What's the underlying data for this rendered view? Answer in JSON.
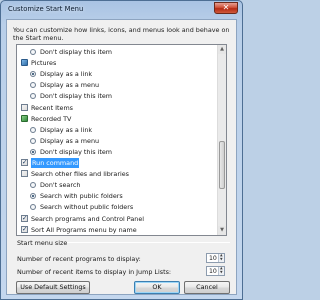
{
  "window": {
    "title": "Customize Start Menu",
    "close_glyph": "✕"
  },
  "description": "You can customize how links, icons, and menus look and behave on the Start menu.",
  "options": [
    {
      "type": "radio",
      "label": "Don't display this item",
      "checked": false,
      "indent": 1
    },
    {
      "type": "icon",
      "icon": "pictures-icon",
      "label": "Pictures",
      "indent": 0
    },
    {
      "type": "radio",
      "label": "Display as a link",
      "checked": true,
      "indent": 1
    },
    {
      "type": "radio",
      "label": "Display as a menu",
      "checked": false,
      "indent": 1
    },
    {
      "type": "radio",
      "label": "Don't display this item",
      "checked": false,
      "indent": 1
    },
    {
      "type": "checkbox",
      "label": "Recent Items",
      "checked": false,
      "indent": 0
    },
    {
      "type": "icon",
      "icon": "recorded-tv-icon",
      "label": "Recorded TV",
      "indent": 0
    },
    {
      "type": "radio",
      "label": "Display as a link",
      "checked": false,
      "indent": 1
    },
    {
      "type": "radio",
      "label": "Display as a menu",
      "checked": false,
      "indent": 1
    },
    {
      "type": "radio",
      "label": "Don't display this item",
      "checked": true,
      "indent": 1
    },
    {
      "type": "checkbox",
      "label": "Run command",
      "checked": true,
      "indent": 0,
      "selected": true
    },
    {
      "type": "checkbox",
      "label": "Search other files and libraries",
      "checked": false,
      "indent": 0
    },
    {
      "type": "radio",
      "label": "Don't search",
      "checked": false,
      "indent": 1
    },
    {
      "type": "radio",
      "label": "Search with public folders",
      "checked": true,
      "indent": 1
    },
    {
      "type": "radio",
      "label": "Search without public folders",
      "checked": false,
      "indent": 1
    },
    {
      "type": "checkbox",
      "label": "Search programs and Control Panel",
      "checked": true,
      "indent": 0
    },
    {
      "type": "checkbox",
      "label": "Sort All Programs menu by name",
      "checked": true,
      "indent": 0
    }
  ],
  "size": {
    "section_label": "Start menu size",
    "recent_programs_label": "Number of recent programs to display:",
    "recent_programs_value": "10",
    "recent_items_label": "Number of recent items to display in Jump Lists:",
    "recent_items_value": "10"
  },
  "buttons": {
    "defaults": "Use Default Settings",
    "ok": "OK",
    "cancel": "Cancel"
  }
}
